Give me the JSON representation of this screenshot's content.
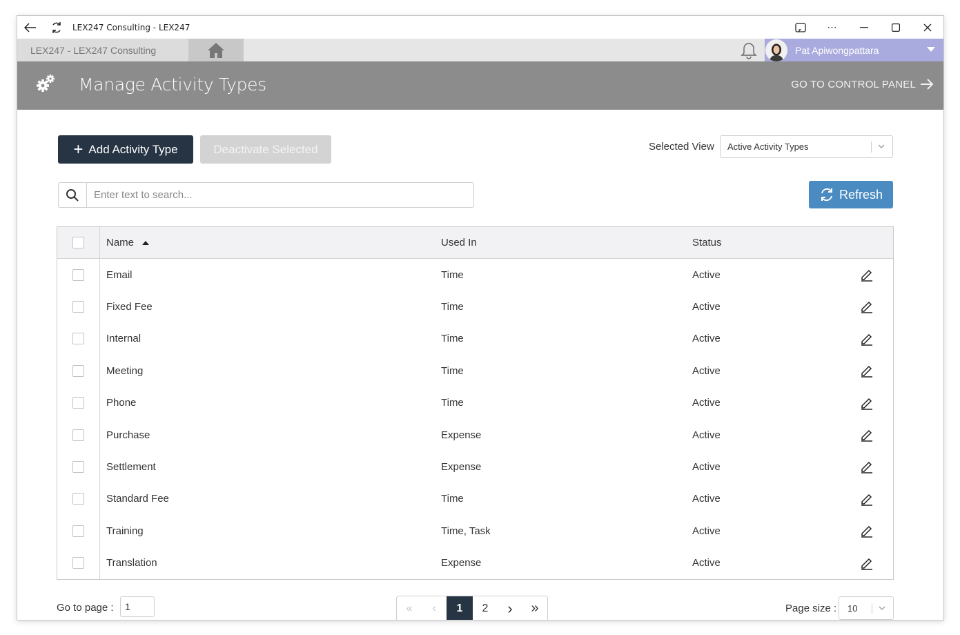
{
  "window": {
    "title": "LEX247 Consulting - LEX247"
  },
  "appbar": {
    "tab_label": "LEX247  -  LEX247 Consulting",
    "user_name": "Pat Apiwongpattara"
  },
  "header": {
    "title": "Manage Activity Types",
    "control_panel_link": "GO TO CONTROL PANEL"
  },
  "toolbar": {
    "add_label": "Add Activity Type",
    "deactivate_label": "Deactivate Selected",
    "view_label": "Selected View",
    "view_value": "Active Activity Types",
    "search_placeholder": "Enter text to search...",
    "refresh_label": "Refresh"
  },
  "grid": {
    "columns": {
      "name": "Name",
      "used_in": "Used In",
      "status": "Status"
    },
    "sort": {
      "column": "name",
      "direction": "ascending"
    },
    "rows": [
      {
        "name": "Email",
        "used_in": "Time",
        "status": "Active"
      },
      {
        "name": "Fixed Fee",
        "used_in": "Time",
        "status": "Active"
      },
      {
        "name": "Internal",
        "used_in": "Time",
        "status": "Active"
      },
      {
        "name": "Meeting",
        "used_in": "Time",
        "status": "Active"
      },
      {
        "name": "Phone",
        "used_in": "Time",
        "status": "Active"
      },
      {
        "name": "Purchase",
        "used_in": "Expense",
        "status": "Active"
      },
      {
        "name": "Settlement",
        "used_in": "Expense",
        "status": "Active"
      },
      {
        "name": "Standard Fee",
        "used_in": "Time",
        "status": "Active"
      },
      {
        "name": "Training",
        "used_in": "Time, Task",
        "status": "Active"
      },
      {
        "name": "Translation",
        "used_in": "Expense",
        "status": "Active"
      }
    ]
  },
  "pager": {
    "goto_label": "Go to page :",
    "goto_value": "1",
    "pages": [
      "1",
      "2"
    ],
    "current_page": "1",
    "page_size_label": "Page size :",
    "page_size_value": "10"
  },
  "colors": {
    "primary_dark": "#273444",
    "refresh_blue": "#4a8bc2",
    "header_gray": "#8c8c8c",
    "user_purple": "#a9aade"
  },
  "icons": [
    "back-arrow-icon",
    "refresh-cycle-icon",
    "cast-icon",
    "more-icon",
    "minimize-icon",
    "maximize-icon",
    "close-icon",
    "home-icon",
    "bell-icon",
    "gear-icon",
    "arrow-right-icon",
    "plus-icon",
    "chevron-down-icon",
    "search-icon",
    "refresh-icon",
    "edit-pencil-icon",
    "first-page-icon",
    "prev-page-icon",
    "next-page-icon",
    "last-page-icon"
  ]
}
